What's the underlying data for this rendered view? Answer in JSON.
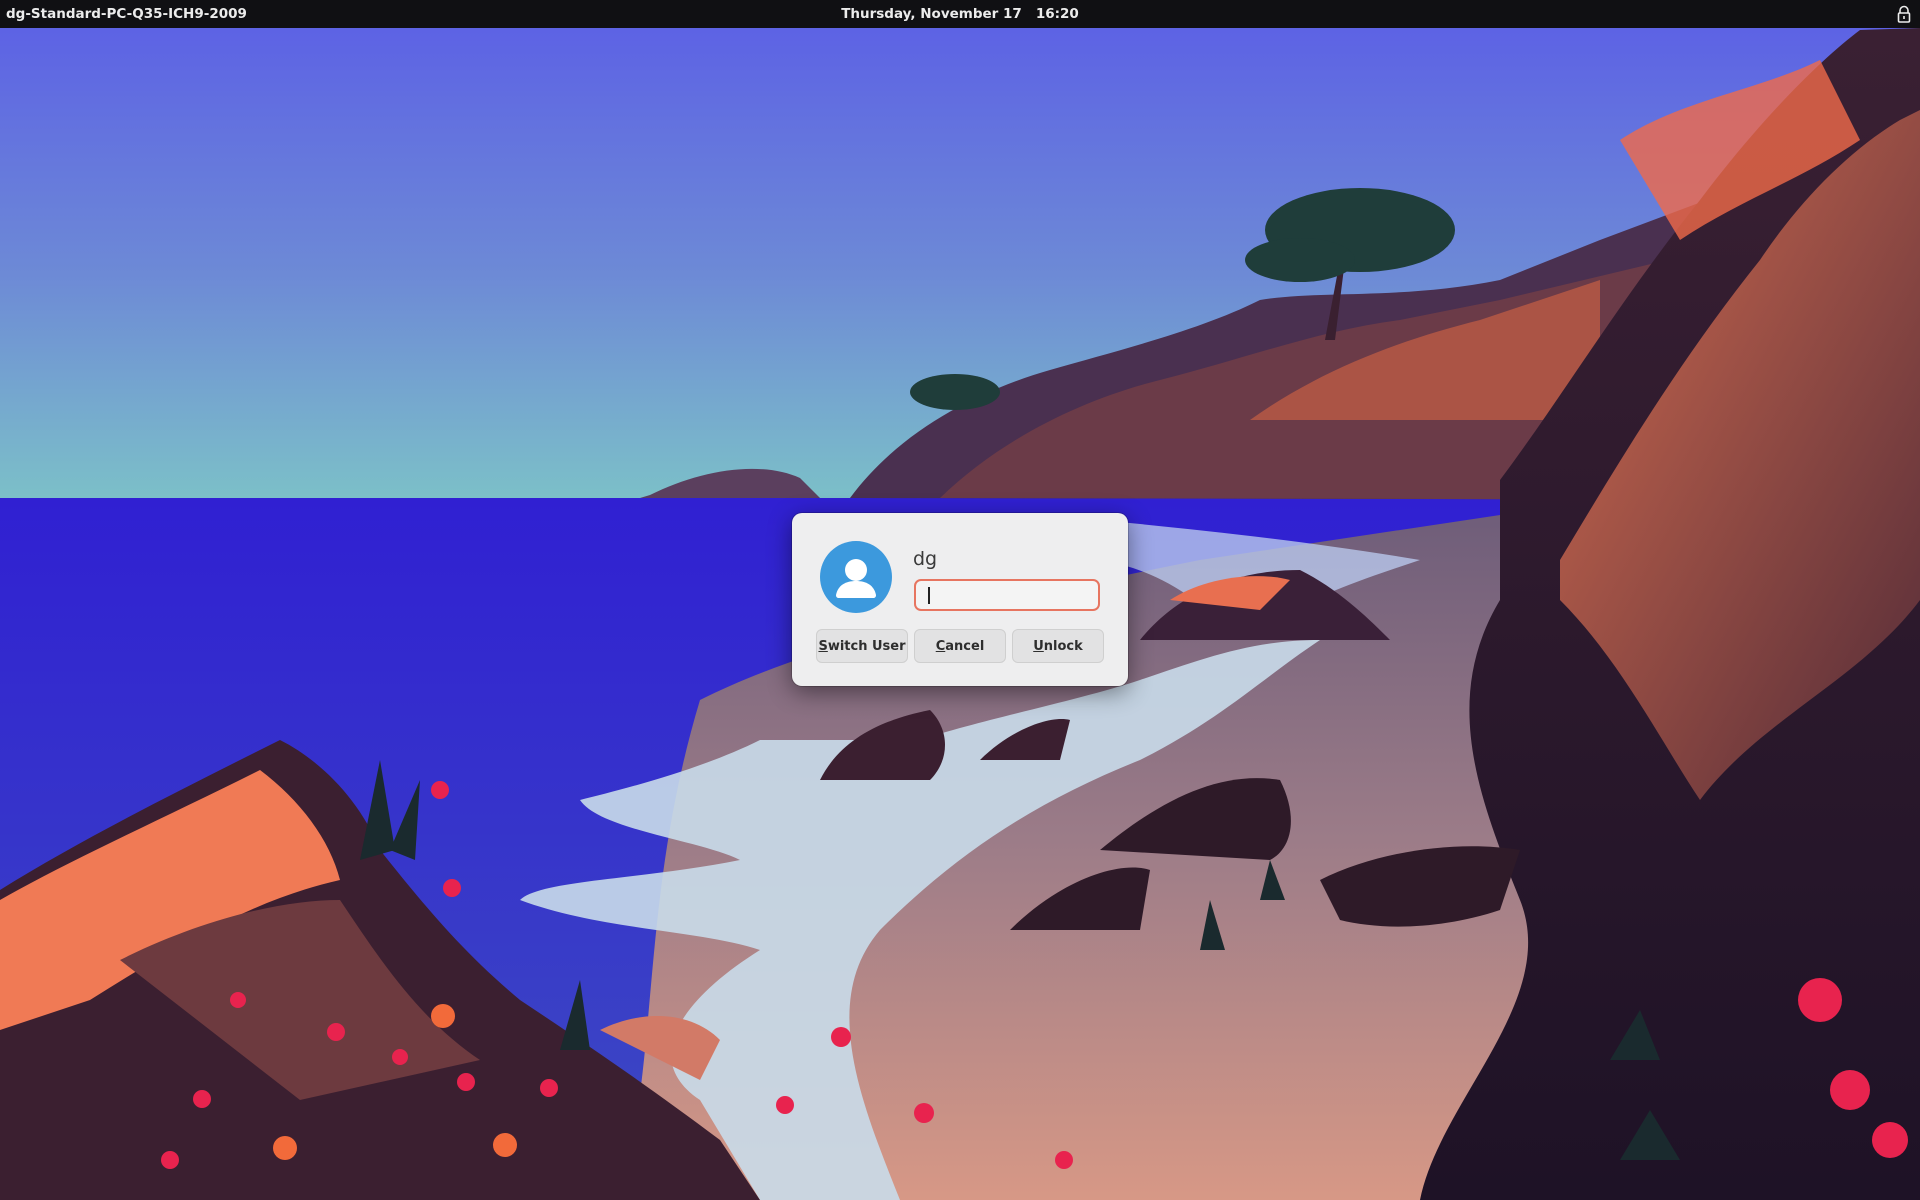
{
  "top_panel": {
    "hostname": "dg-Standard-PC-Q35-ICH9-2009",
    "date": "Thursday, November 17",
    "time": "16:20",
    "lock_icon": "lock-icon"
  },
  "unlock_dialog": {
    "avatar_icon": "user-avatar-icon",
    "username": "dg",
    "password_value": "",
    "buttons": {
      "switch_user": {
        "mnemonic": "S",
        "rest": "witch User"
      },
      "cancel": {
        "mnemonic": "C",
        "rest": "ancel"
      },
      "unlock": {
        "mnemonic": "U",
        "rest": "nlock"
      }
    }
  },
  "colors": {
    "panel_bg": "#101013",
    "dialog_bg": "#eeeeef",
    "input_focus_border": "#e77560",
    "avatar_bg": "#3c99dd",
    "sky_top": "#5b5ee6",
    "sea": "#3a2fd6"
  }
}
